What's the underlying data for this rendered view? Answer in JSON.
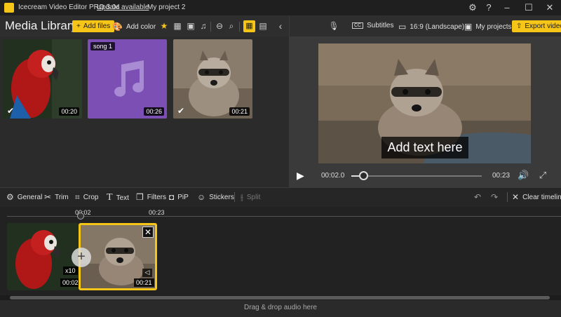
{
  "titlebar": {
    "app_name": "Icecream Video Editor PRO 3.04",
    "update_link": "Update available",
    "project_name": "My project 2",
    "icons": [
      "gear-icon",
      "help-icon",
      "minimize-icon",
      "maximize-icon",
      "close-icon"
    ]
  },
  "library": {
    "title": "Media Library",
    "add_files_label": "Add files",
    "add_color_label": "Add color",
    "items": [
      {
        "type": "video",
        "subject": "parrot",
        "duration": "00:20",
        "checked": true
      },
      {
        "type": "audio",
        "label": "song 1",
        "duration": "00:26",
        "color": "#7b4fb4"
      },
      {
        "type": "video",
        "subject": "raccoon",
        "duration": "00:21",
        "checked": true
      }
    ]
  },
  "preview_header": {
    "subtitles_label": "Subtitles",
    "aspect_label": "16:9 (Landscape)",
    "projects_label": "My projects",
    "export_label": "Export video"
  },
  "player": {
    "overlay_text": "Add text here",
    "current_time": "00:02.0",
    "total_time": "00:23",
    "progress": 0.09
  },
  "tools": {
    "general": "General",
    "trim": "Trim",
    "crop": "Crop",
    "text": "Text",
    "filters": "Filters",
    "pip": "PiP",
    "stickers": "Stickers",
    "split": "Split",
    "clear_timeline": "Clear timeline"
  },
  "timeline": {
    "marker_current": "00:02",
    "marker_end": "00:23",
    "clip1": {
      "speed": "x10",
      "duration": "00:02"
    },
    "clip2": {
      "duration": "00:21"
    },
    "audio_drop": "Drag & drop audio here"
  },
  "colors": {
    "accent": "#f5c518",
    "song_tile": "#7b4fb4"
  }
}
